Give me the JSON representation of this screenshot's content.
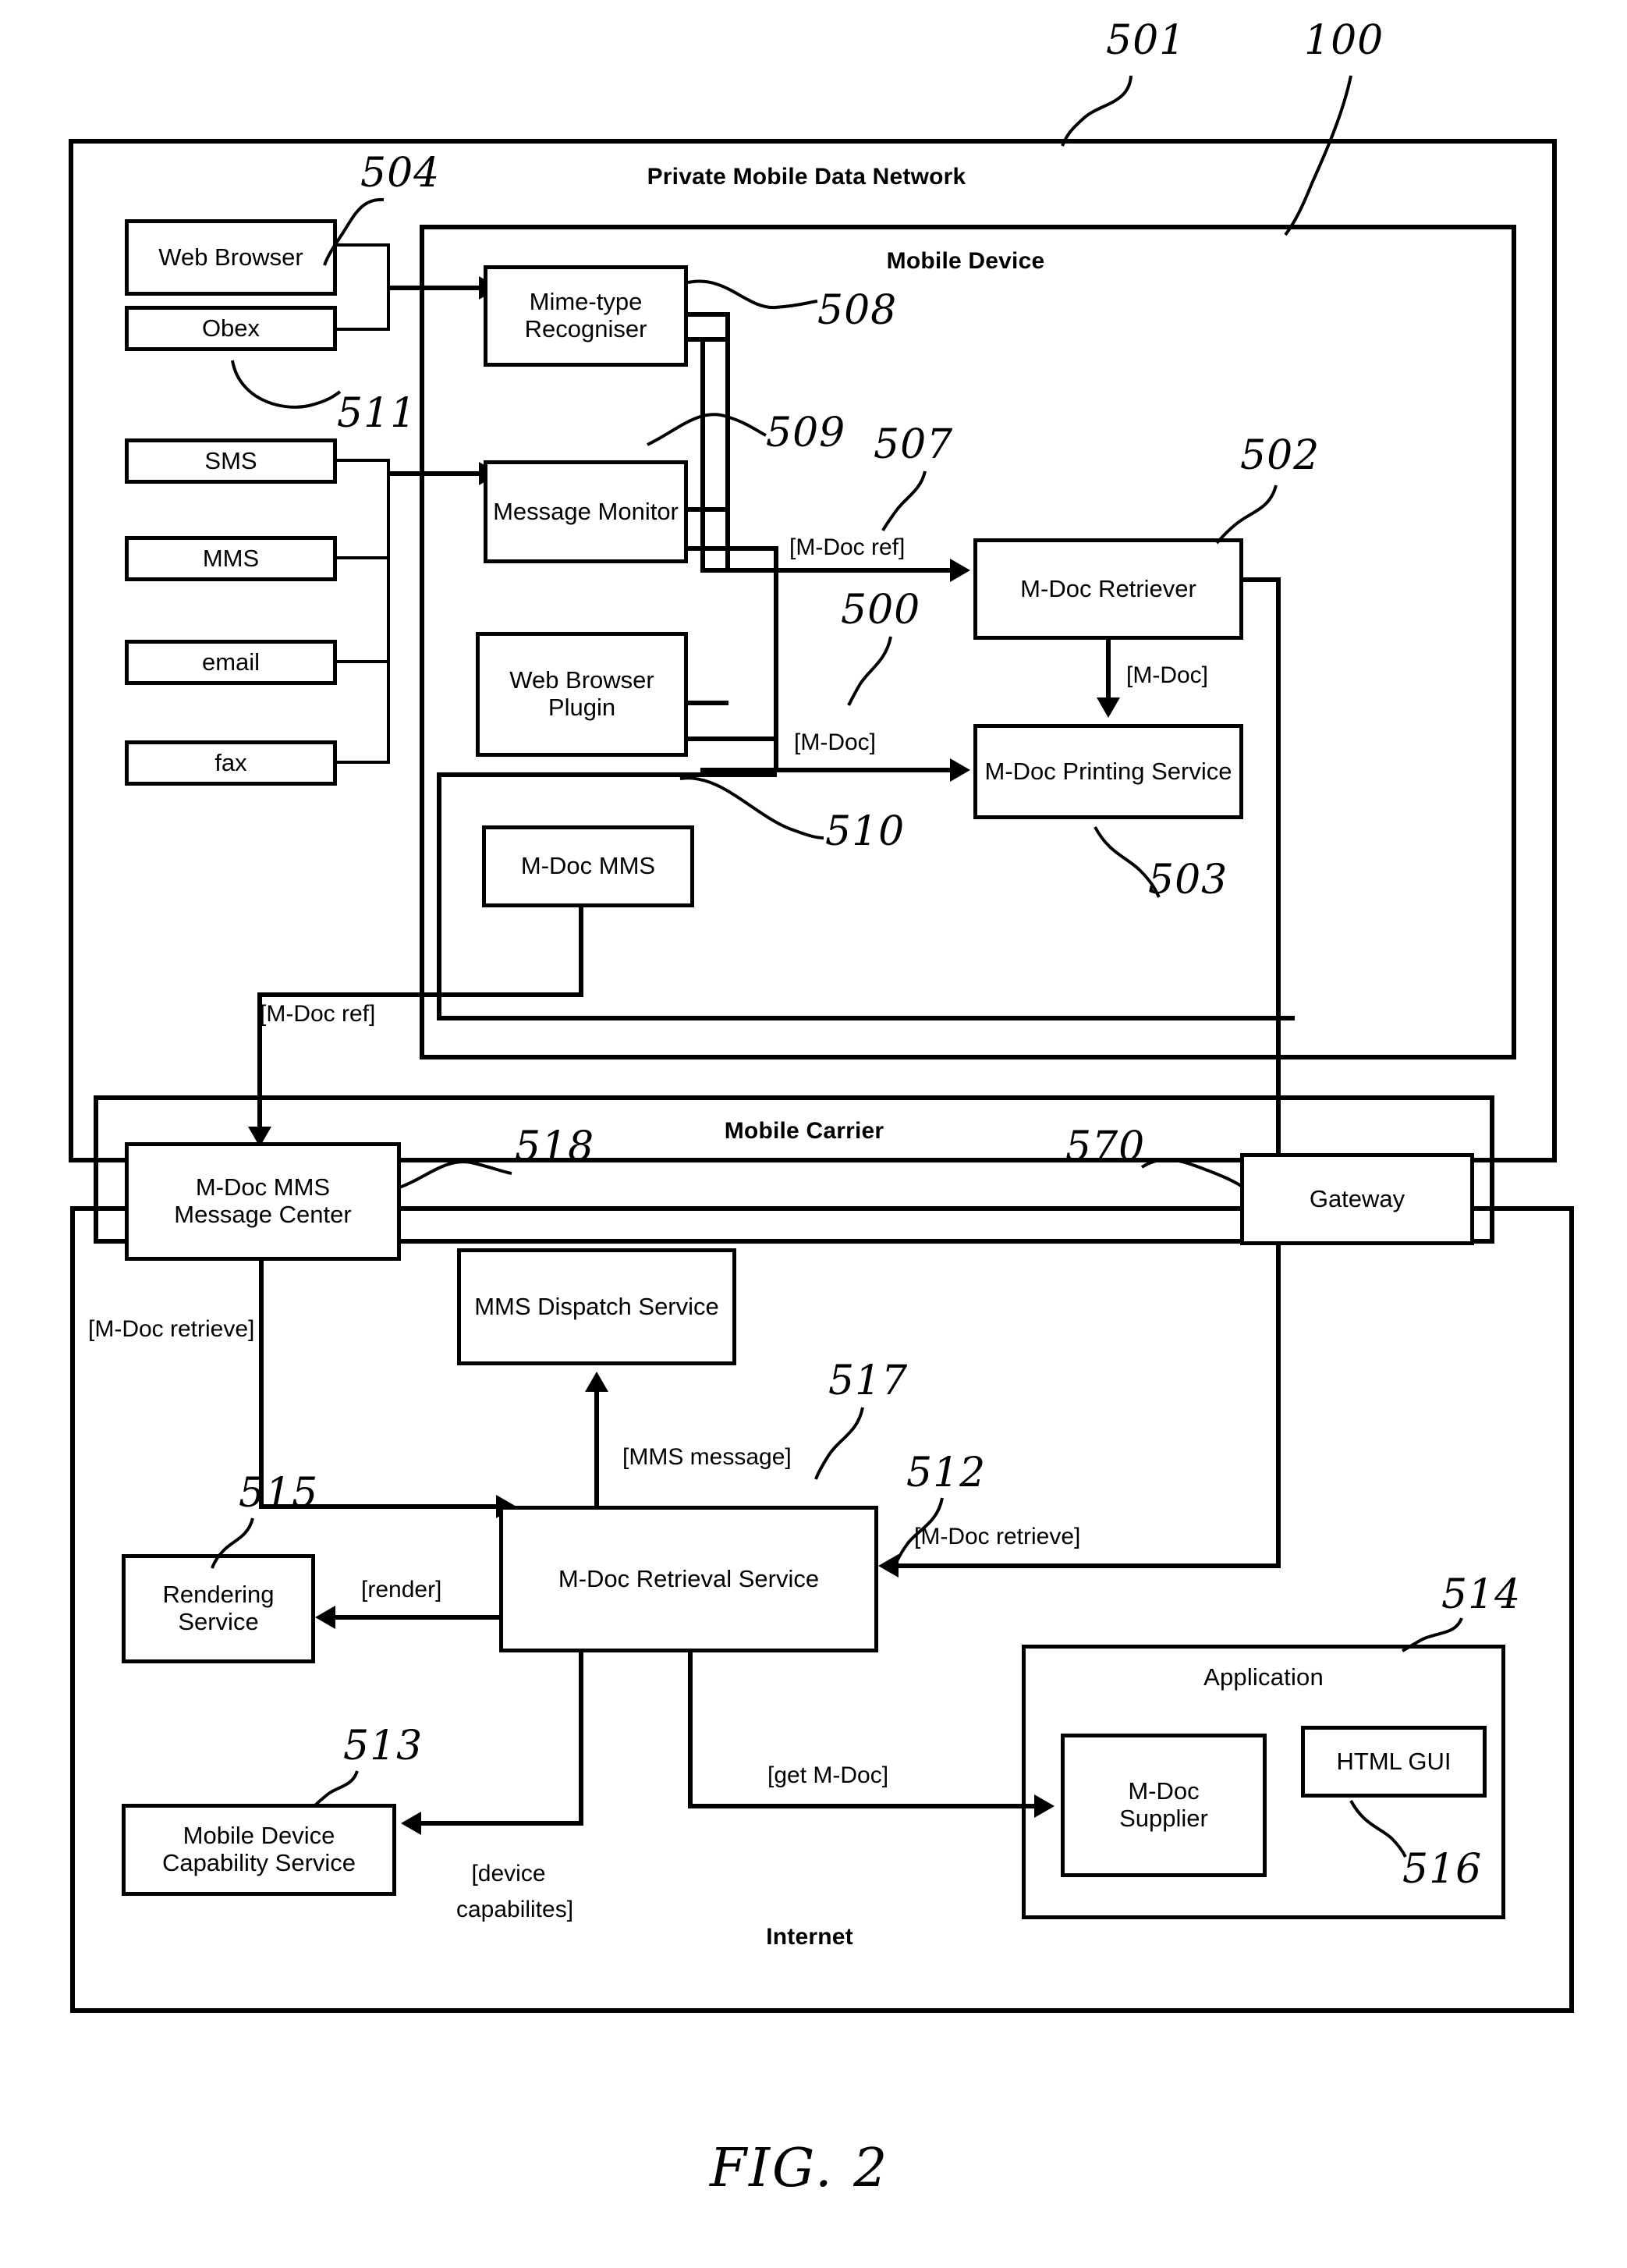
{
  "figure": {
    "caption": "FIG. 2",
    "title": "Private Mobile Data Network"
  },
  "frames": [
    {
      "id": "private_mobile_data_network",
      "label": "Private Mobile Data Network",
      "ref": "501"
    },
    {
      "id": "mobile_device",
      "label": "Mobile Device",
      "ref": "100"
    },
    {
      "id": "mobile_carrier",
      "label": "Mobile Carrier",
      "ref": ""
    },
    {
      "id": "internet",
      "label": "Internet",
      "ref": ""
    }
  ],
  "boxes": {
    "web_browser": "Web Browser",
    "obex": "Obex",
    "sms": "SMS",
    "mms": "MMS",
    "email": "email",
    "fax": "fax",
    "mime_type_recogniser": "Mime-type Recogniser",
    "message_monitor": "Message Monitor",
    "web_browser_plugin": "Web Browser Plugin",
    "m_doc_mms": "M-Doc MMS",
    "m_doc_retriever": "M-Doc Retriever",
    "m_doc_printing_service": "M-Doc Printing Service",
    "m_doc_mms_message_center_l1": "M-Doc MMS",
    "m_doc_mms_message_center_l2": "Message Center",
    "gateway": "Gateway",
    "mms_dispatch_service": "MMS Dispatch Service",
    "rendering_service": "Rendering Service",
    "m_doc_retrieval_service": "M-Doc Retrieval Service",
    "mobile_device_capability_service_l1": "Mobile Device",
    "mobile_device_capability_service_l2": "Capability Service",
    "application": "Application",
    "m_doc_supplier_l1": "M-Doc",
    "m_doc_supplier_l2": "Supplier",
    "html_gui": "HTML GUI"
  },
  "edge_labels": {
    "m_doc_ref_device": "[M-Doc ref]",
    "m_doc_device": "[M-Doc]",
    "m_doc_down": "[M-Doc]",
    "m_doc_ref_carrier": "[M-Doc ref]",
    "m_doc_retrieve_left": "[M-Doc retrieve]",
    "mms_message": "[MMS message]",
    "render": "[render]",
    "m_doc_retrieve_right": "[M-Doc retrieve]",
    "get_m_doc": "[get M-Doc]",
    "device_capabilities_l1": "[device",
    "device_capabilities_l2": "capabilites]"
  },
  "reference_numerals": {
    "n501": "501",
    "n100": "100",
    "n504": "504",
    "n508": "508",
    "n511": "511",
    "n509": "509",
    "n507": "507",
    "n502": "502",
    "n500": "500",
    "n510": "510",
    "n503": "503",
    "n518": "518",
    "n570": "570",
    "n517": "517",
    "n515": "515",
    "n512": "512",
    "n514": "514",
    "n513": "513",
    "n516": "516"
  },
  "colors": {
    "ink": "#000000",
    "paper": "#ffffff"
  }
}
